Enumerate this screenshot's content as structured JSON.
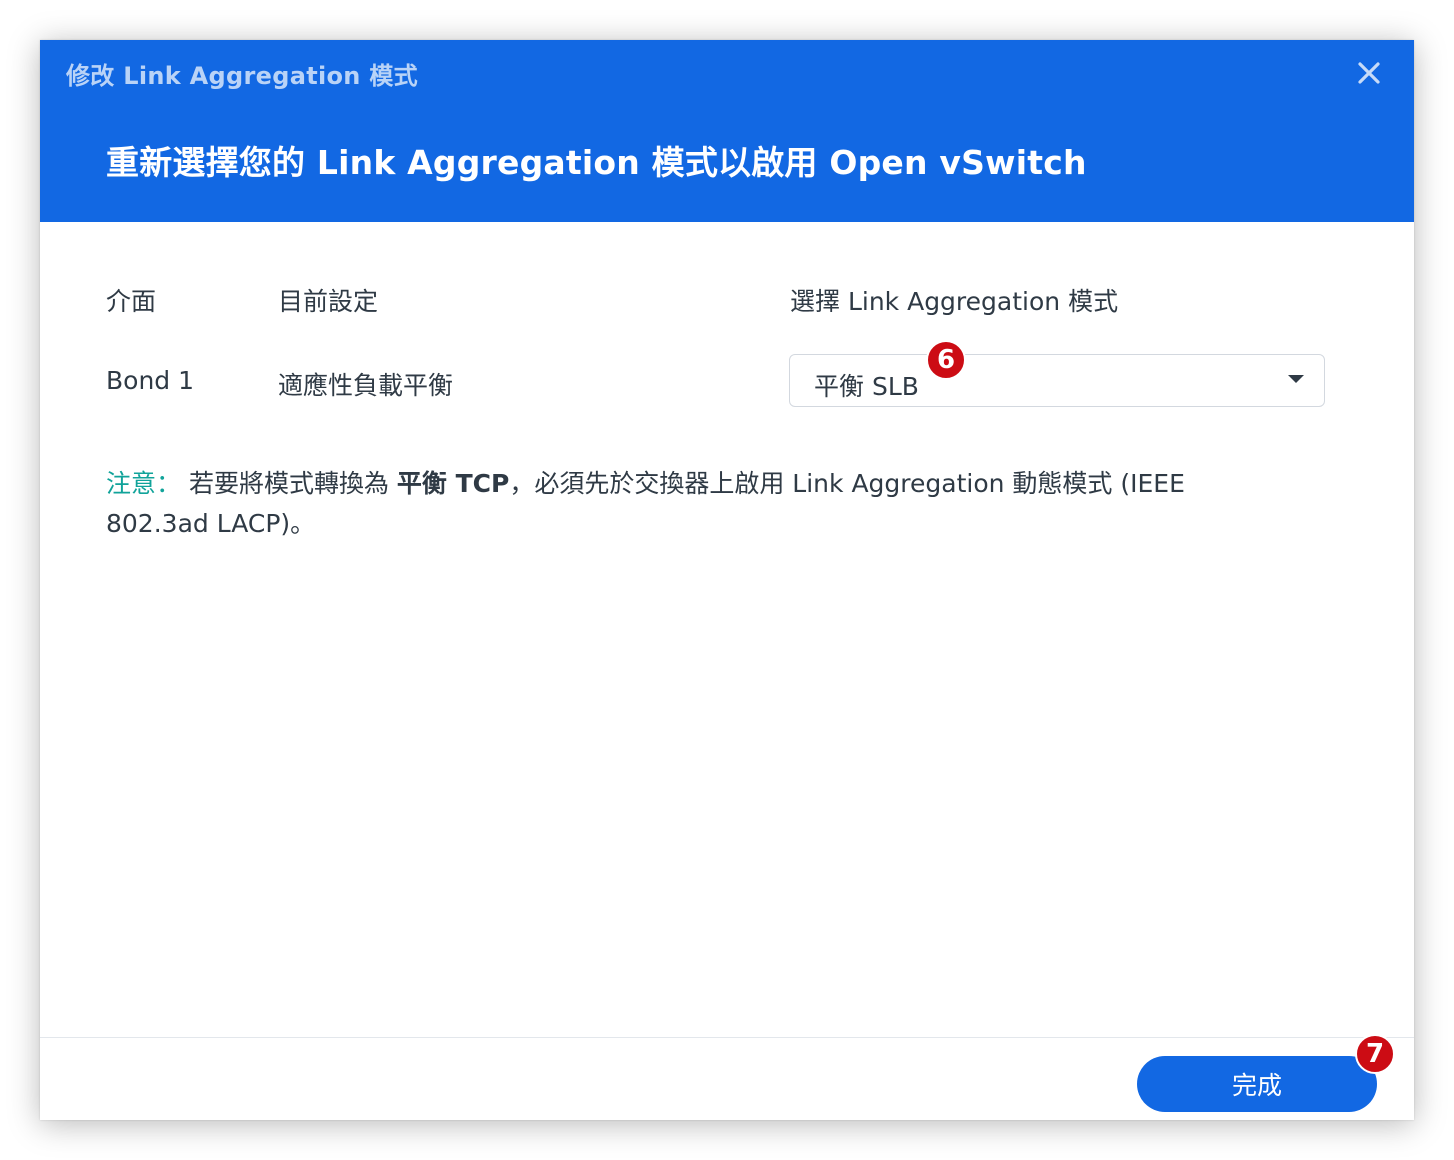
{
  "window": {
    "title": "修改 Link Aggregation 模式",
    "heading": "重新選擇您的 Link Aggregation 模式以啟用 Open vSwitch"
  },
  "table": {
    "headers": {
      "interface": "介面",
      "current": "目前設定",
      "select_mode": "選擇 Link Aggregation 模式"
    },
    "row": {
      "interface": "Bond 1",
      "current": "適應性負載平衡",
      "selected_mode": "平衡 SLB"
    }
  },
  "note": {
    "label": "注意：",
    "text_before": " 若要將模式轉換為 ",
    "bold": "平衡 TCP",
    "text_after": "，必須先於交換器上啟用 Link Aggregation 動態模式 (IEEE 802.3ad LACP)。"
  },
  "footer": {
    "done_label": "完成"
  },
  "badges": {
    "select": "6",
    "done": "7"
  },
  "colors": {
    "header_bg": "#1268e3",
    "accent_teal": "#11a39a",
    "badge_red": "#cc0c14"
  },
  "icons": {
    "close": "close-icon",
    "dropdown": "caret-down-icon"
  }
}
